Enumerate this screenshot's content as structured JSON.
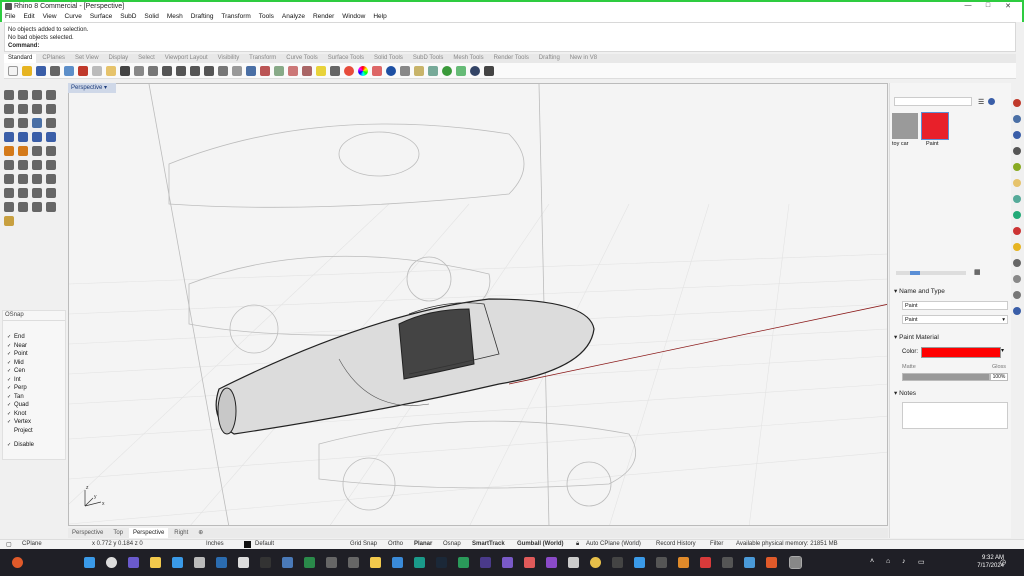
{
  "window": {
    "title": "Rhino 8 Commercial - [Perspective]"
  },
  "menu": [
    "File",
    "Edit",
    "View",
    "Curve",
    "Surface",
    "SubD",
    "Solid",
    "Mesh",
    "Drafting",
    "Transform",
    "Tools",
    "Analyze",
    "Render",
    "Window",
    "Help"
  ],
  "command_history": [
    "No objects added to selection.",
    "No bad objects selected."
  ],
  "command_prompt": "Command:",
  "toolbar_tabs": [
    "Standard",
    "CPlanes",
    "Set View",
    "Display",
    "Select",
    "Viewport Layout",
    "Visibility",
    "Transform",
    "Curve Tools",
    "Surface Tools",
    "Solid Tools",
    "SubD Tools",
    "Mesh Tools",
    "Render Tools",
    "Drafting",
    "New in V8"
  ],
  "active_toolbar_tab": "Standard",
  "viewport": {
    "label": "Perspective",
    "axes": {
      "x": "x",
      "y": "y",
      "z": "z"
    }
  },
  "osnap": {
    "title": "OSnap",
    "items": [
      {
        "label": "End",
        "checked": true
      },
      {
        "label": "Near",
        "checked": true
      },
      {
        "label": "Point",
        "checked": true
      },
      {
        "label": "Mid",
        "checked": true
      },
      {
        "label": "Cen",
        "checked": true
      },
      {
        "label": "Int",
        "checked": true
      },
      {
        "label": "Perp",
        "checked": true
      },
      {
        "label": "Tan",
        "checked": true
      },
      {
        "label": "Quad",
        "checked": true
      },
      {
        "label": "Knot",
        "checked": true
      },
      {
        "label": "Vertex",
        "checked": true
      },
      {
        "label": "Project",
        "checked": false
      }
    ],
    "disable": {
      "label": "Disable",
      "checked": true
    }
  },
  "viewport_tabs": [
    "Perspective",
    "Top",
    "Perspective",
    "Right"
  ],
  "active_viewport_tab_index": 2,
  "status_bar": {
    "cplane": "CPlane",
    "coords": "x 0.772  y 0.184  z 0",
    "units": "Inches",
    "layer": "Default",
    "grid_snap": "Grid Snap",
    "ortho": "Ortho",
    "planar": "Planar",
    "osnap": "Osnap",
    "smarttrack": "SmartTrack",
    "gumball": "Gumball (World)",
    "auto_cplane": "Auto CPlane (World)",
    "record_history": "Record History",
    "filter": "Filter",
    "memory": "Available physical memory: 21851 MB"
  },
  "materials": {
    "thumbs": [
      {
        "label": "toy car",
        "color": "#9a9a9a"
      },
      {
        "label": "Paint",
        "color": "#e8202a"
      }
    ],
    "name_type_header": "Name and Type",
    "name_value": "Paint",
    "type_value": "Paint",
    "paint_material_header": "Paint Material",
    "color_label": "Color:",
    "color_value": "#ff0000",
    "matte_label": "Matte",
    "gloss_label": "Gloss",
    "gloss_pct": "100%",
    "gloss_fraction": 1.0,
    "notes_header": "Notes"
  },
  "clock": {
    "time": "9:32 AM",
    "date": "7/17/2024"
  }
}
